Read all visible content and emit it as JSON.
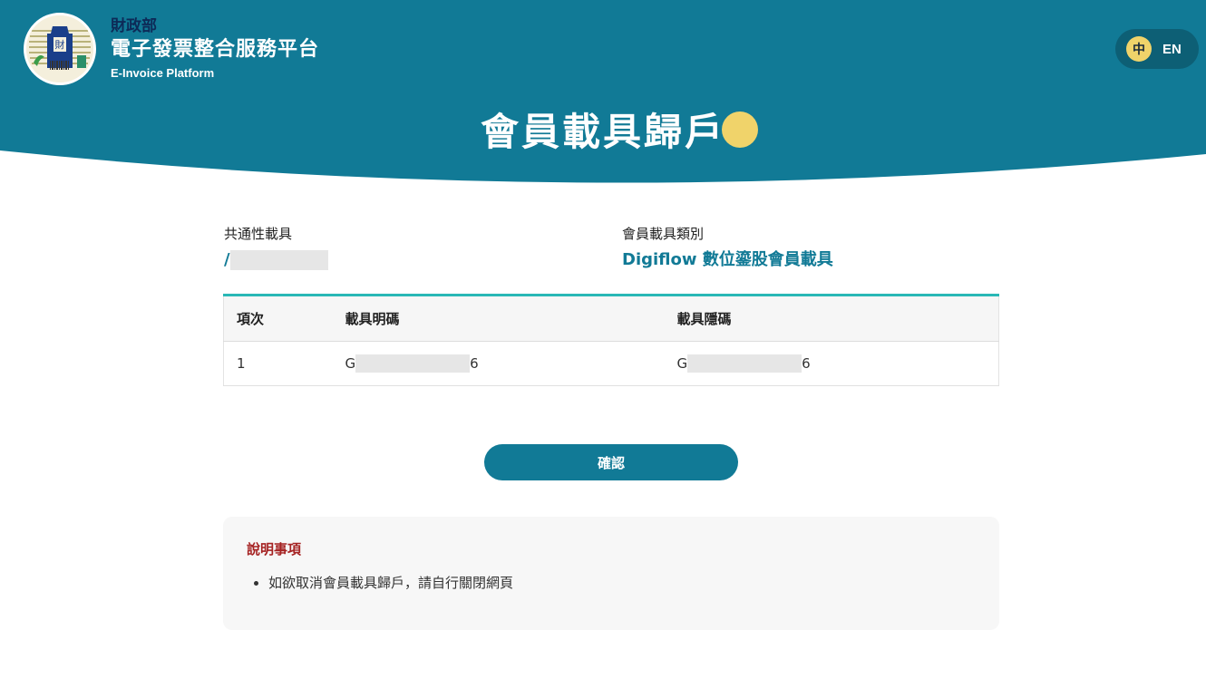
{
  "header": {
    "ministry": "財政部",
    "platform_name": "電子發票整合服務平台",
    "platform_name_en": "E-Invoice Platform",
    "lang_zh": "中",
    "lang_en": "EN"
  },
  "page_title": "會員載具歸戶",
  "info": {
    "common_carrier_label": "共通性載具",
    "common_carrier_value": "/",
    "member_carrier_type_label": "會員載具類別",
    "member_carrier_type_value": "Digiflow 數位鎏股會員載具"
  },
  "table": {
    "headers": [
      "項次",
      "載具明碼",
      "載具隱碼"
    ],
    "rows": [
      {
        "index": "1",
        "plain_prefix": "G",
        "plain_suffix": "6",
        "hidden_prefix": "G",
        "hidden_suffix": "6"
      }
    ]
  },
  "confirm_label": "確認",
  "notes": {
    "title": "說明事項",
    "items": [
      "如欲取消會員載具歸戶，請自行關閉網頁"
    ]
  },
  "colors": {
    "header_teal": "#117a96",
    "accent_yellow": "#f0d36a",
    "table_top_border": "#2ab8b6",
    "notes_title": "#a52222"
  }
}
